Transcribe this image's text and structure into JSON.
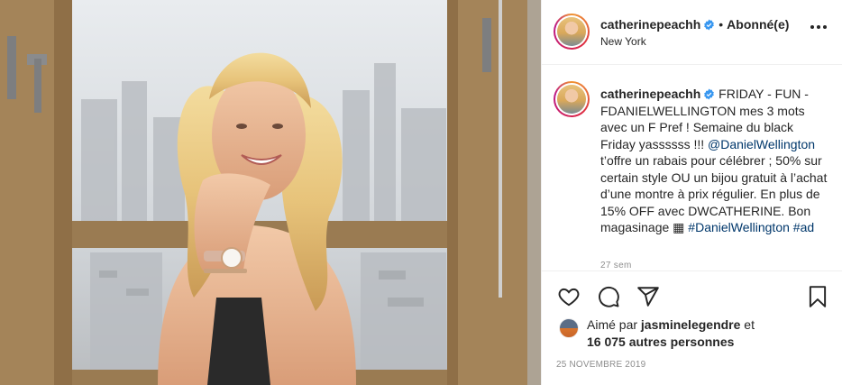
{
  "post": {
    "username": "catherinepeachh",
    "follow_separator": "•",
    "follow_status": "Abonné(e)",
    "location": "New York",
    "caption": {
      "username": "catherinepeachh",
      "text_1": " FRIDAY - FUN - FDANIELWELLINGTON mes 3 mots avec un F Pref ! Semaine du black Friday yassssss !!! ",
      "mention": "@DanielWellington",
      "text_2": " t’offre un rabais pour célébrer ; 50% sur certain style OU un bijou gratuit à l’achat d’une montre à prix régulier. En plus de 15% OFF avec DWCATHERINE. Bon magasinage ",
      "emoji": "▦",
      "hashtag_1": "#DanielWellington",
      "hashtag_2": "#ad",
      "time_ago": "27 sem"
    },
    "likes": {
      "prefix": "Aimé par ",
      "user": "jasminelegendre",
      "conj": " et",
      "others": "16 075 autres personnes"
    },
    "date": "25 NOVEMBRE 2019"
  },
  "colors": {
    "text": "#262626",
    "link": "#00376b",
    "muted": "#8e8e8e",
    "verified": "#3897f0",
    "divider": "#efefef"
  },
  "icons": [
    "verified-badge-icon",
    "more-options-icon",
    "heart-icon",
    "comment-icon",
    "share-icon",
    "bookmark-icon"
  ]
}
